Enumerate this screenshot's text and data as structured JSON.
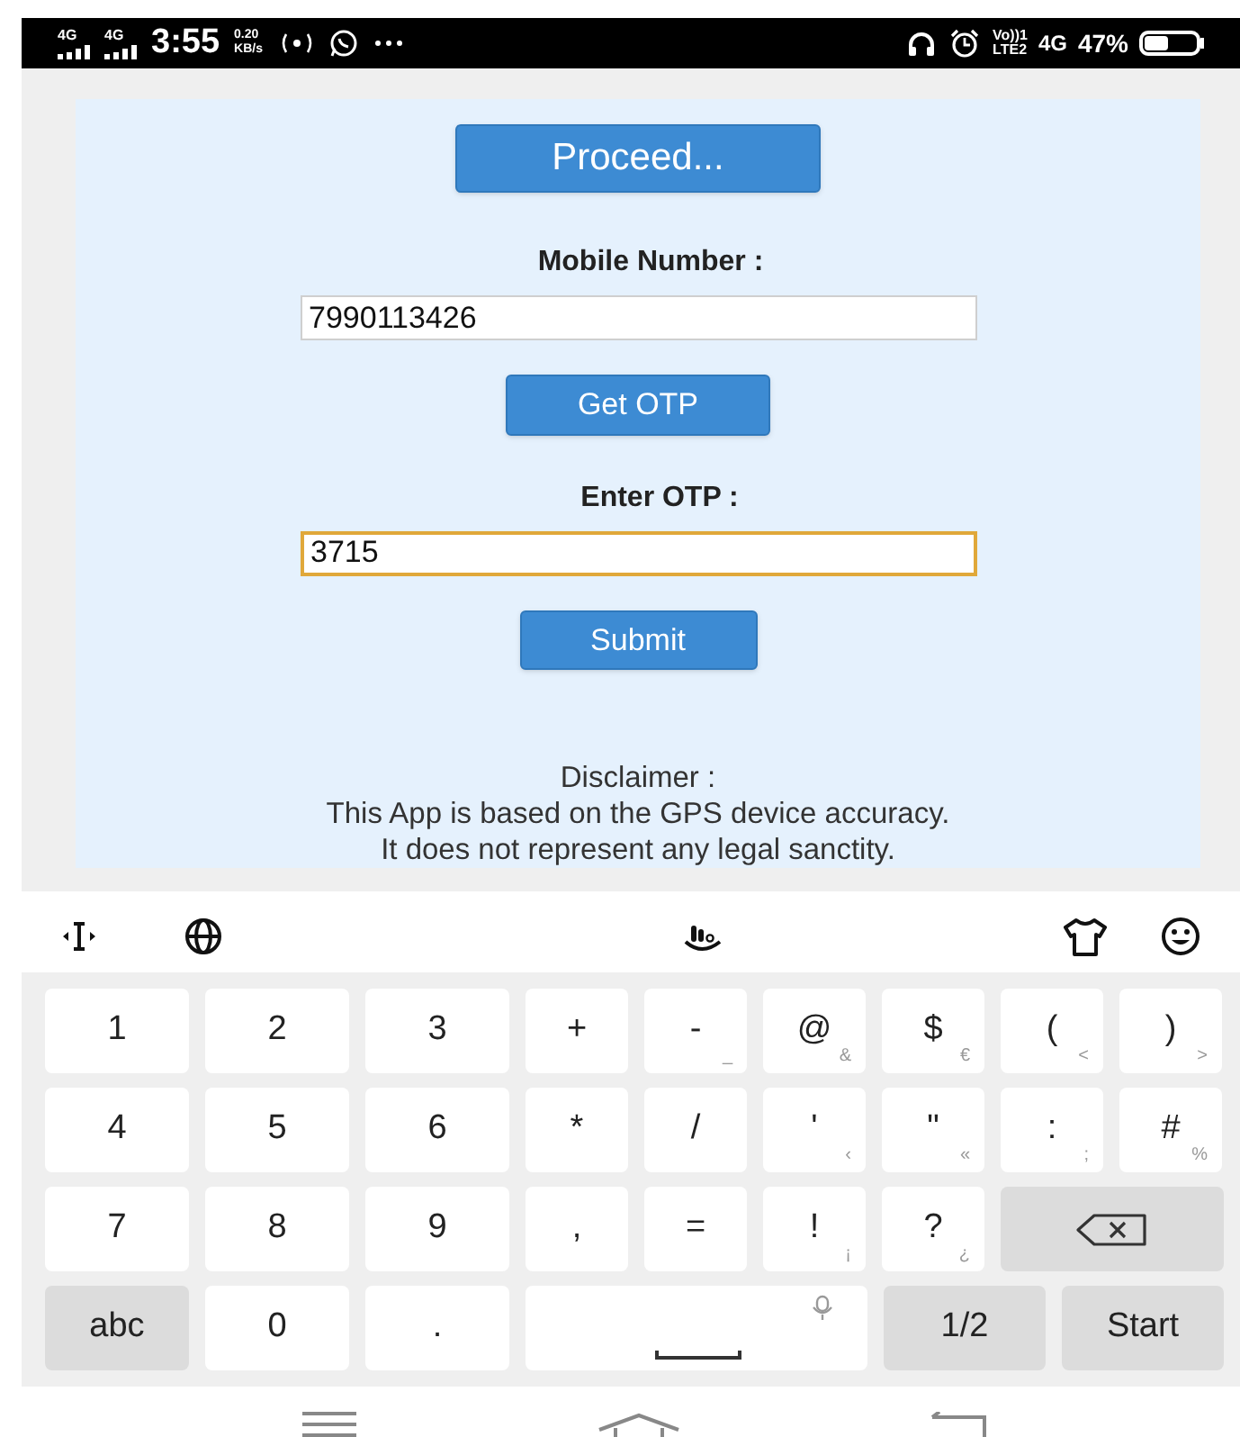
{
  "status_bar": {
    "left": [
      "4G",
      "4G"
    ],
    "time": "3:55",
    "speed": [
      "0.20",
      "KB/s"
    ],
    "volte": [
      "Vo))1",
      "LTE2"
    ],
    "network": "4G",
    "battery": "47%"
  },
  "form": {
    "proceed_button": "Proceed...",
    "fields": [
      {
        "label": "Mobile Number :",
        "value": "7990113426",
        "focused": false,
        "button": "Get OTP"
      },
      {
        "label": "Enter OTP :",
        "value": "3715",
        "focused": true,
        "button": "Submit"
      }
    ],
    "disclaimer": [
      "Disclaimer :",
      "This App is based on the GPS device accuracy.",
      "It does not represent any legal sanctity."
    ]
  },
  "keyboard": {
    "rows": [
      {
        "keys": [
          {
            "kind": "digit",
            "label": "1"
          },
          {
            "kind": "digit",
            "label": "2"
          },
          {
            "kind": "digit",
            "label": "3"
          },
          {
            "kind": "symbol",
            "label": "+"
          },
          {
            "kind": "symbol",
            "label": "-",
            "sub": "_"
          },
          {
            "kind": "symbol",
            "label": "@",
            "sub": "&"
          },
          {
            "kind": "symbol",
            "label": "$",
            "sub": "€"
          },
          {
            "kind": "symbol",
            "label": "(",
            "sub": "<"
          },
          {
            "kind": "symbol",
            "label": ")",
            "sub": ">"
          }
        ]
      },
      {
        "keys": [
          {
            "kind": "digit",
            "label": "4"
          },
          {
            "kind": "digit",
            "label": "5"
          },
          {
            "kind": "digit",
            "label": "6"
          },
          {
            "kind": "symbol",
            "label": "*"
          },
          {
            "kind": "symbol",
            "label": "/"
          },
          {
            "kind": "symbol",
            "label": "'",
            "sub": "‹"
          },
          {
            "kind": "symbol",
            "label": "\"",
            "sub": "«"
          },
          {
            "kind": "symbol",
            "label": ":",
            "sub": ";"
          },
          {
            "kind": "symbol",
            "label": "#",
            "sub": "%"
          }
        ]
      },
      {
        "keys": [
          {
            "kind": "digit",
            "label": "7"
          },
          {
            "kind": "digit",
            "label": "8"
          },
          {
            "kind": "digit",
            "label": "9"
          },
          {
            "kind": "symbol",
            "label": ","
          },
          {
            "kind": "symbol",
            "label": "="
          },
          {
            "kind": "symbol",
            "label": "!",
            "sub": "¡"
          },
          {
            "kind": "symbol",
            "label": "?",
            "sub": "¿"
          },
          {
            "kind": "backspace"
          }
        ]
      },
      {
        "keys": [
          {
            "kind": "mode",
            "label": "abc"
          },
          {
            "kind": "digit",
            "label": "0"
          },
          {
            "kind": "digit",
            "label": "."
          },
          {
            "kind": "space"
          },
          {
            "kind": "action",
            "label": "1/2"
          },
          {
            "kind": "action",
            "label": "Start"
          }
        ]
      }
    ]
  }
}
